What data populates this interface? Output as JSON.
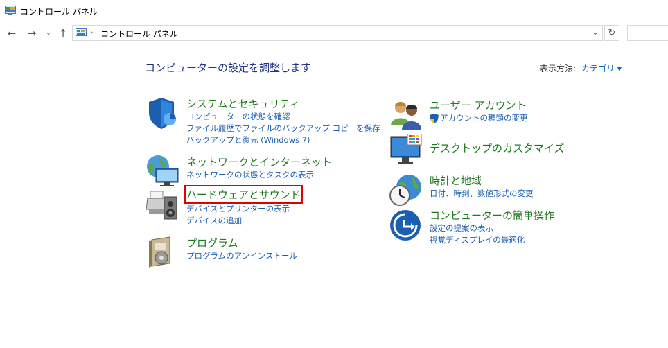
{
  "window": {
    "title": "コントロール パネル"
  },
  "nav": {
    "back_glyph": "←",
    "forward_glyph": "→",
    "recent_glyph": "⌄",
    "up_glyph": "↑",
    "address_sep": "›",
    "address_crumb": "コントロール パネル",
    "address_dropdown_glyph": "⌄",
    "refresh_glyph": "↻",
    "search_placeholder": ""
  },
  "page": {
    "title": "コンピューターの設定を調整します",
    "view_by_label": "表示方法:",
    "view_by_value": "カテゴリ ▾"
  },
  "categories": {
    "security": {
      "heading": "システムとセキュリティ",
      "links": [
        "コンピューターの状態を確認",
        "ファイル履歴でファイルのバックアップ コピーを保存",
        "バックアップと復元 (Windows 7)"
      ]
    },
    "network": {
      "heading": "ネットワークとインターネット",
      "links": [
        "ネットワークの状態とタスクの表示"
      ]
    },
    "hardware": {
      "heading": "ハードウェアとサウンド",
      "links": [
        "デバイスとプリンターの表示",
        "デバイスの追加"
      ]
    },
    "programs": {
      "heading": "プログラム",
      "links": [
        "プログラムのアンインストール"
      ]
    },
    "users": {
      "heading": "ユーザー アカウント",
      "links": [
        "アカウントの種類の変更"
      ]
    },
    "appearance": {
      "heading": "デスクトップのカスタマイズ",
      "links": []
    },
    "clock": {
      "heading": "時計と地域",
      "links": [
        "日付、時刻、数値形式の変更"
      ]
    },
    "ease": {
      "heading": "コンピューターの簡単操作",
      "links": [
        "設定の提案の表示",
        "視覚ディスプレイの最適化"
      ]
    }
  },
  "icons": {
    "app": "control-panel-icon",
    "security": "shield-icon",
    "network": "network-globe-icon",
    "hardware": "printer-speaker-icon",
    "programs": "program-box-icon",
    "users": "users-icon",
    "appearance": "desktop-monitor-icon",
    "clock": "clock-globe-icon",
    "ease": "ease-of-access-icon",
    "uac": "uac-shield-icon"
  },
  "colors": {
    "heading": "#1e7a1e",
    "link": "#1a5fb4",
    "title": "#1e3287",
    "highlight": "#e00000"
  }
}
